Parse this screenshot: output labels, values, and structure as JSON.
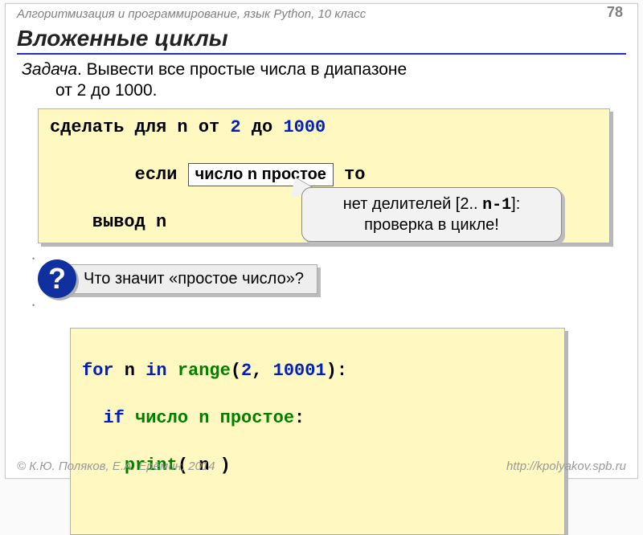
{
  "header": {
    "course": "Алгоритмизация и программирование, язык Python, 10 класс",
    "page": "78"
  },
  "title": "Вложенные циклы",
  "task": {
    "label": "Задача",
    "text1": ". Вывести все простые числа в диапазоне",
    "text2": "от 2 до 1000."
  },
  "pseudo": {
    "l1a": "сделать для n от ",
    "l1n1": "2",
    "l1b": " до ",
    "l1n2": "1000",
    "l2a": "  если ",
    "l2boxed": "число n простое",
    "l2b": " то",
    "l3": "    вывод n"
  },
  "callout": {
    "line1a": "нет делителей [2.. ",
    "n1": "n-1",
    "line1b": "]:",
    "line2": "проверка в цикле!"
  },
  "question": "Что значит «простое число»?",
  "python": {
    "l1_for": "for",
    "l1_n": " n ",
    "l1_in": "in",
    "l1_sp": " ",
    "l1_range": "range",
    "l1_p1": "(",
    "l1_a1": "2",
    "l1_c": ", ",
    "l1_a2": "10001",
    "l1_p2": "):",
    "l2_if": "  if",
    "l2_txt": " число n простое",
    "l2_colon": ":",
    "l3_sp": "    ",
    "l3_print": "print",
    "l3_p": "( n )"
  },
  "footer": {
    "left": "© К.Ю. Поляков, Е.А. Ерёмин, 2014",
    "right": "http://kpolyakov.spb.ru"
  }
}
